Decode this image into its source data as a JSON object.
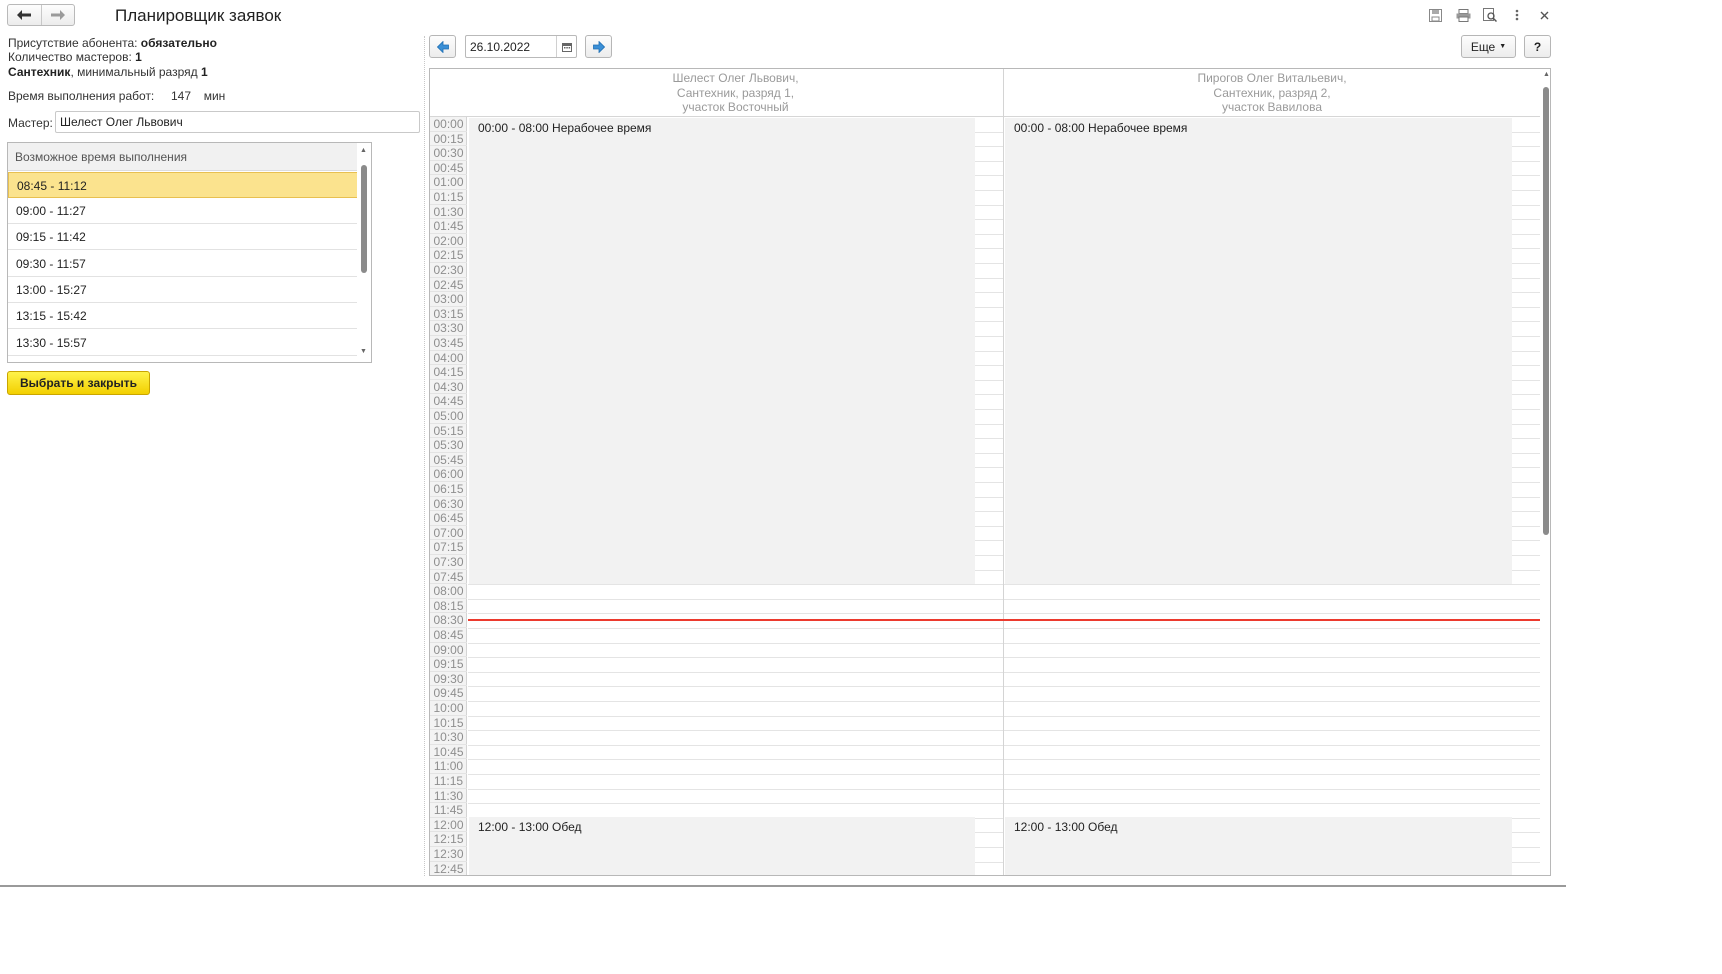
{
  "window": {
    "title": "Планировщик заявок",
    "back_icon": "arrow-left-icon",
    "forward_icon": "arrow-right-icon",
    "actions": [
      "save-icon",
      "print-icon",
      "preview-icon",
      "more-vertical-icon",
      "close-icon"
    ]
  },
  "info": {
    "presence_label": "Присутствие абонента: ",
    "presence_value": "обязательно",
    "masters_count_label": "Количество мастеров: ",
    "masters_count_value": "1",
    "specialty_bold": "Сантехник",
    "specialty_rest": ", минимальный разряд ",
    "specialty_grade": "1",
    "work_time_label": "Время выполнения работ:",
    "work_time_value": "147",
    "work_time_unit": "мин"
  },
  "master": {
    "label": "Мастер:",
    "value": "Шелест Олег Львович"
  },
  "times": {
    "header": "Возможное время выполнения",
    "items": [
      "08:45 - 11:12",
      "09:00 - 11:27",
      "09:15 - 11:42",
      "09:30 - 11:57",
      "13:00 - 15:27",
      "13:15 - 15:42",
      "13:30 - 15:57"
    ],
    "selected_index": 0
  },
  "primary_button": "Выбрать и закрыть",
  "toolbar": {
    "date": "26.10.2022",
    "more_label": "Еще",
    "help_label": "?"
  },
  "scheduler": {
    "columns": [
      {
        "line1": "Шелест Олег Львович,",
        "line2": "Сантехник, разряд 1,",
        "line3": "участок Восточный",
        "block1": "00:00 - 08:00 Нерабочее время",
        "block2": "12:00 - 13:00 Обед"
      },
      {
        "line1": "Пирогов Олег Витальевич,",
        "line2": "Сантехник, разряд 2,",
        "line3": "участок Вавилова",
        "block1": "00:00 - 08:00 Нерабочее время",
        "block2": "12:00 - 13:00 Обед"
      }
    ],
    "time_labels": [
      "00:00",
      "00:15",
      "00:30",
      "00:45",
      "01:00",
      "01:15",
      "01:30",
      "01:45",
      "02:00",
      "02:15",
      "02:30",
      "02:45",
      "03:00",
      "03:15",
      "03:30",
      "03:45",
      "04:00",
      "04:15",
      "04:30",
      "04:45",
      "05:00",
      "05:15",
      "05:30",
      "05:45",
      "06:00",
      "06:15",
      "06:30",
      "06:45",
      "07:00",
      "07:15",
      "07:30",
      "07:45",
      "08:00",
      "08:15",
      "08:30",
      "08:45",
      "09:00",
      "09:15",
      "09:30",
      "09:45",
      "10:00",
      "10:15",
      "10:30",
      "10:45",
      "11:00",
      "11:15",
      "11:30",
      "11:45",
      "12:00",
      "12:15",
      "12:30",
      "12:45"
    ],
    "current_time_line_color": "#ec3a2e"
  },
  "colors": {
    "accent_yellow": "#f7d918",
    "selected_row": "#fbe38e",
    "nav_blue": "#3a8fd6"
  }
}
